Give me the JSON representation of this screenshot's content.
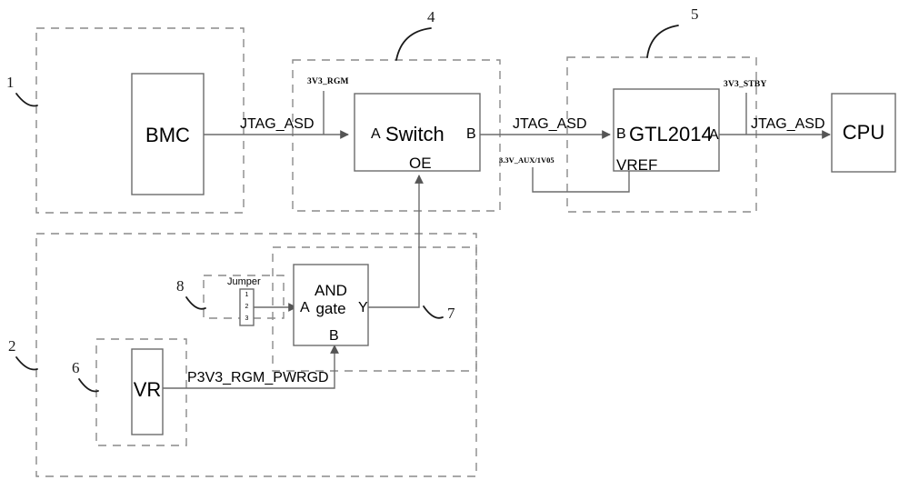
{
  "diagram": {
    "title": "JTAG_ASD signal routing block diagram",
    "colors": {
      "stroke": "#6b6b6b",
      "dashed": "#8a8a8a",
      "wire": "#6b6b6b",
      "text": "#000000",
      "background": "#ffffff"
    }
  },
  "blocks": {
    "bmc": {
      "label": "BMC"
    },
    "switch": {
      "label": "Switch",
      "pin_a": "A",
      "pin_b": "B",
      "pin_oe": "OE"
    },
    "gtl": {
      "label": "GTL2014",
      "pin_b": "B",
      "pin_a": "A",
      "pin_vref": "VREF"
    },
    "cpu": {
      "label": "CPU"
    },
    "and_gate": {
      "label_line1": "AND",
      "label_line2": "gate",
      "pin_a": "A",
      "pin_b": "B",
      "pin_y": "Y"
    },
    "vr": {
      "label": "VR"
    },
    "jumper": {
      "title": "Jumper",
      "pins": [
        "1",
        "2",
        "3"
      ]
    }
  },
  "nets": {
    "jtag_bmc_switch": "JTAG_ASD",
    "jtag_switch_gtl": "JTAG_ASD",
    "jtag_gtl_cpu": "JTAG_ASD",
    "pwrgd": "P3V3_RGM_PWRGD"
  },
  "rails": {
    "rgm": "3V3_RGM",
    "aux": "3.3V_AUX/1V05",
    "stby": "3V3_STBY"
  },
  "callouts": {
    "c1": "1",
    "c2": "2",
    "c4": "4",
    "c5": "5",
    "c6": "6",
    "c7": "7",
    "c8": "8"
  }
}
